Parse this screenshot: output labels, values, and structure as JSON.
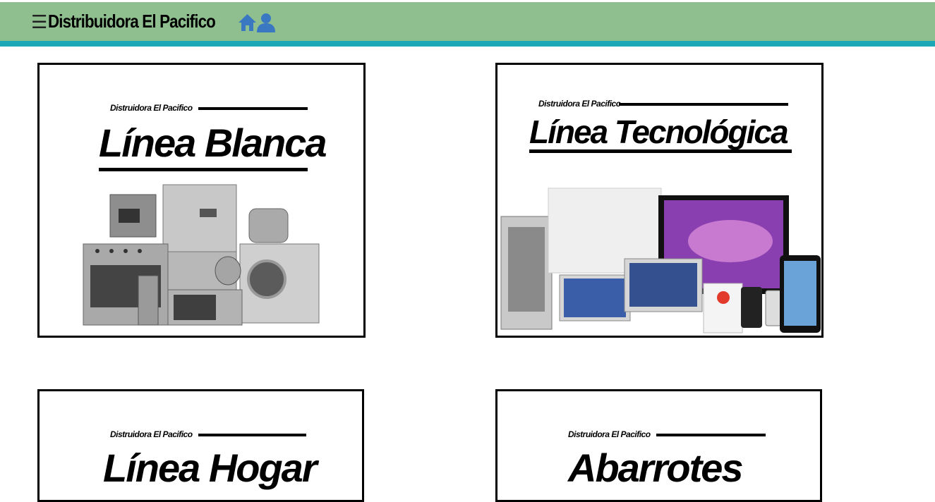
{
  "header": {
    "brand": "Distribuidora El Pacifico",
    "menu_icon": "hamburger-menu-icon",
    "home_icon": "home-icon",
    "user_icon": "user-icon",
    "bar_color": "#8fbf8f",
    "accent_color": "#1ea7b5"
  },
  "cards": [
    {
      "subtitle": "Distruidora El Pacifico",
      "title": "Línea Blanca",
      "image": "home-appliances"
    },
    {
      "subtitle": "Distruidora El Pacifico",
      "title": "Línea Tecnológica",
      "image": "apple-devices"
    },
    {
      "subtitle": "Distruidora El Pacifico",
      "title": "Línea Hogar",
      "image": "home-goods"
    },
    {
      "subtitle": "Distruidora El Pacifico",
      "title": "Abarrotes",
      "image": "groceries"
    }
  ]
}
